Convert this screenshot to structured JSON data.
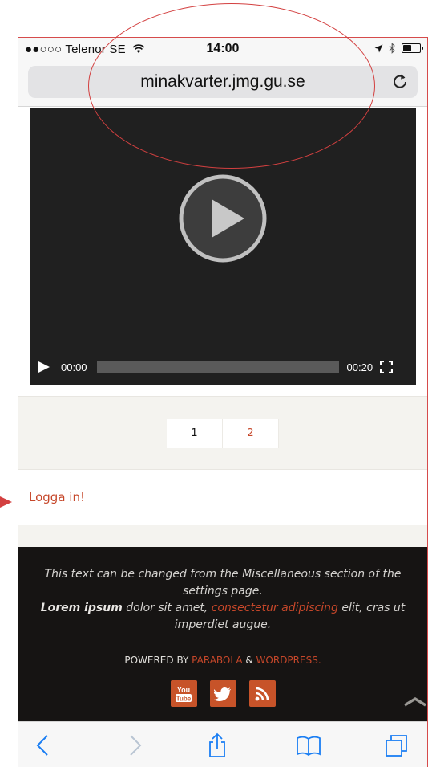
{
  "status_bar": {
    "carrier": "●●○○○ Telenor SE",
    "time": "14:00",
    "battery_level": 0.5
  },
  "browser": {
    "url": "minakvarter.jmg.gu.se"
  },
  "video": {
    "current_time": "00:00",
    "duration": "00:20",
    "progress": 0
  },
  "pagination": {
    "pages": [
      "1",
      "2"
    ],
    "current": "1"
  },
  "login": {
    "label": "Logga in!"
  },
  "footer": {
    "text_line1": "This text can be changed from the Miscellaneous section of the settings page.",
    "lorem_bold": "Lorem ipsum",
    "lorem_mid": " dolor sit amet, ",
    "lorem_link": "consectetur adipiscing",
    "lorem_end": " elit, cras ut imperdiet augue.",
    "powered_prefix": "POWERED BY ",
    "powered_link1": "PARABOLA",
    "powered_amp": " & ",
    "powered_link2": "WORDPRESS."
  },
  "socials": [
    "youtube-icon",
    "twitter-icon",
    "rss-icon"
  ],
  "colors": {
    "accent": "#c6472a",
    "annotation": "#d34040",
    "footer_bg": "#161413",
    "video_bg": "#202020"
  }
}
